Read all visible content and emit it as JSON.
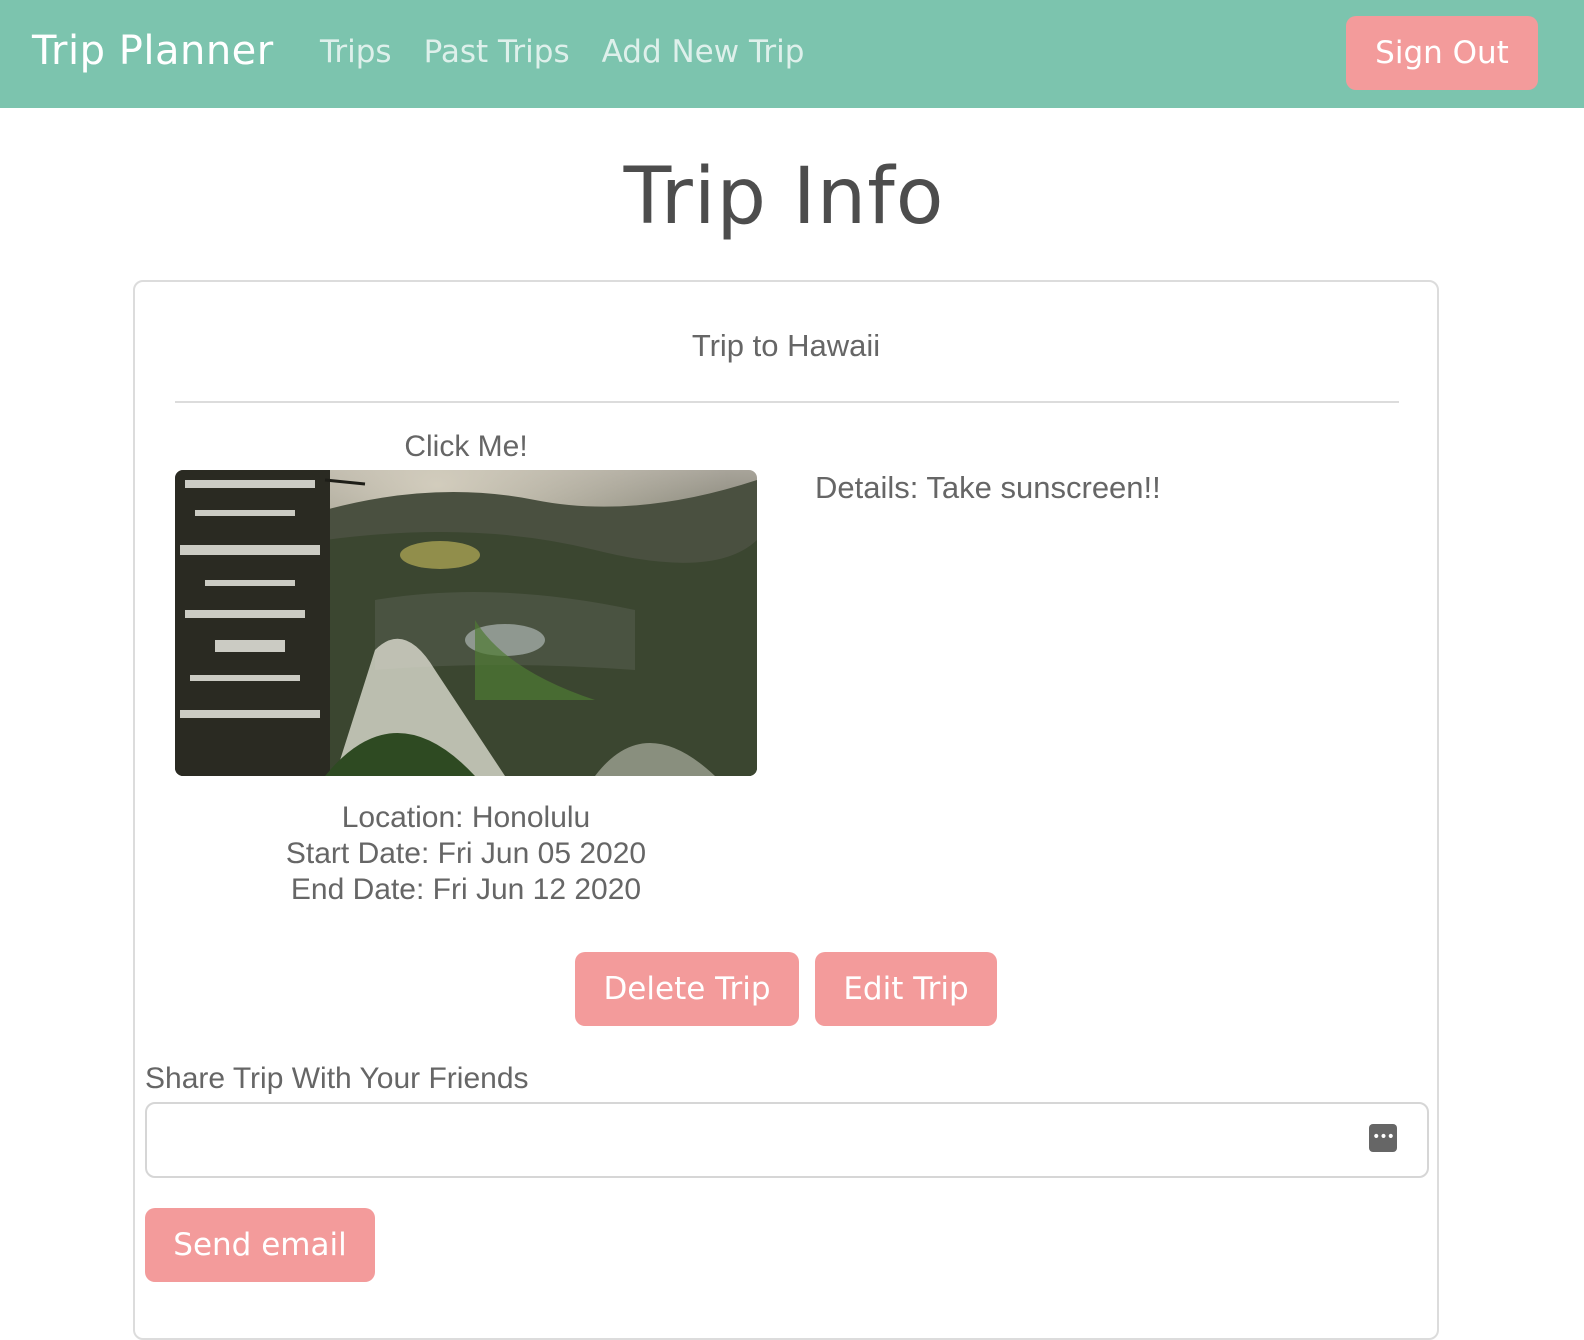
{
  "navbar": {
    "brand": "Trip Planner",
    "links": [
      "Trips",
      "Past Trips",
      "Add New Trip"
    ],
    "sign_out": "Sign Out"
  },
  "page": {
    "title": "Trip Info"
  },
  "trip": {
    "title": "Trip to Hawaii",
    "image_caption": "Click Me!",
    "location": "Location: Honolulu",
    "start_date": "Start Date: Fri Jun 05 2020",
    "end_date": "End Date: Fri Jun 12 2020",
    "details": "Details: Take sunscreen!!"
  },
  "actions": {
    "delete": "Delete Trip",
    "edit": "Edit Trip"
  },
  "share": {
    "label": "Share Trip With Your Friends",
    "input_value": "",
    "input_placeholder": "",
    "send": "Send email",
    "input_icon": "password-manager-icon"
  },
  "colors": {
    "navbar": "#7cc4ae",
    "accent_button": "#f39b9b",
    "text_muted": "#666666"
  }
}
